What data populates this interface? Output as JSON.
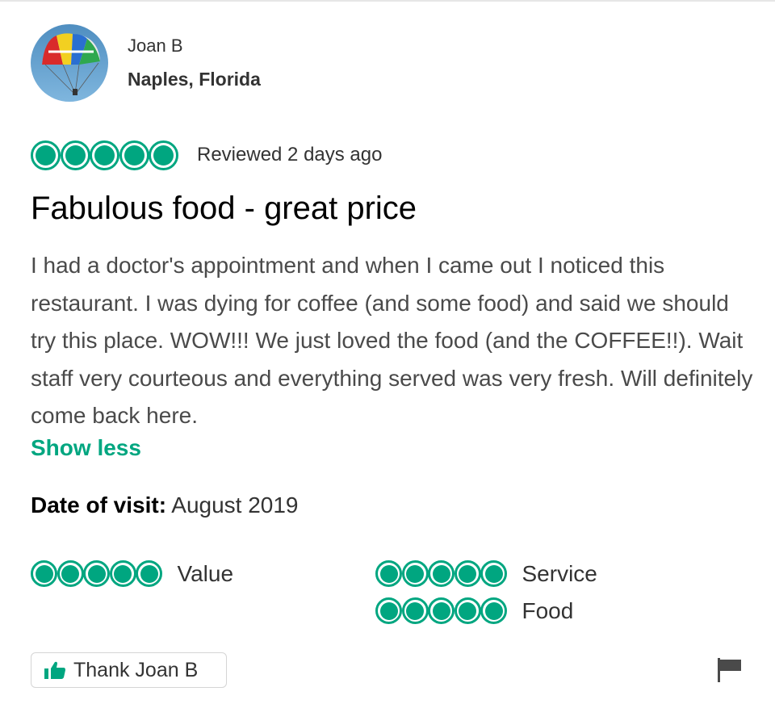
{
  "reviewer": {
    "name": "Joan B",
    "location": "Naples, Florida"
  },
  "review": {
    "rating": 5,
    "rating_max": 5,
    "reviewed_text": "Reviewed 2 days ago",
    "title": "Fabulous food - great price",
    "body": "I had a doctor's appointment and when I came out I noticed this restaurant. I was dying for coffee (and some food) and said we should try this place. WOW!!! We just loved the food (and the COFFEE!!). Wait staff very courteous and everything served was very fresh. Will definitely come back here.",
    "show_less_label": "Show less",
    "date_of_visit_label": "Date of visit:",
    "date_of_visit_value": "August 2019"
  },
  "subratings": [
    {
      "label": "Value",
      "rating": 5
    },
    {
      "label": "Service",
      "rating": 5
    },
    {
      "label": "Food",
      "rating": 5
    }
  ],
  "actions": {
    "thank_label": "Thank Joan B",
    "thumbs_icon": "thumbs-up-icon",
    "flag_icon": "flag-icon"
  },
  "colors": {
    "accent": "#00a680",
    "text": "#333333",
    "title": "#000000"
  }
}
